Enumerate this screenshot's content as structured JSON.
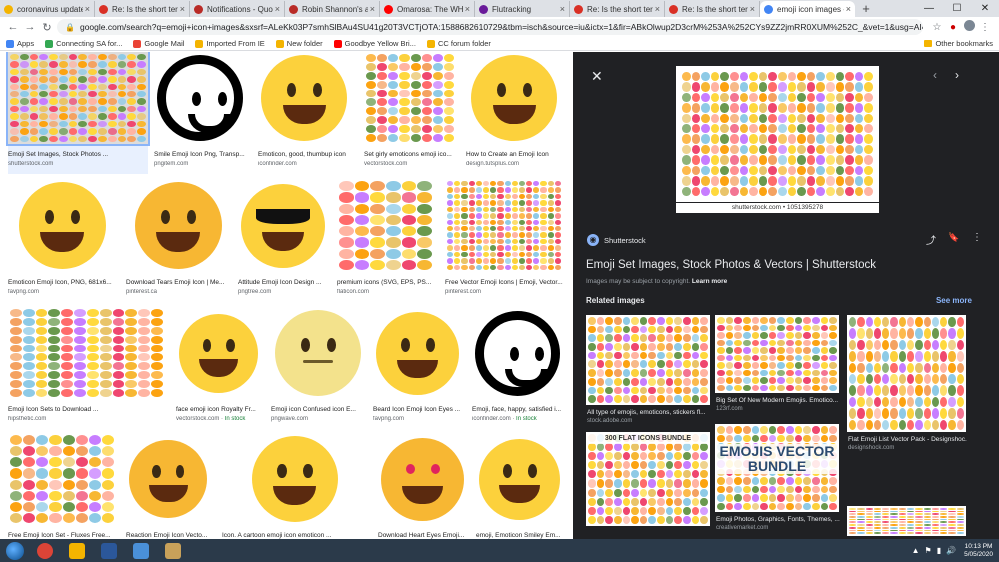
{
  "tabs": [
    {
      "label": "coronavirus update we",
      "fav_color": "#f4b400",
      "active": false
    },
    {
      "label": "Re: Is the short term re",
      "fav_color": "#d93025",
      "active": false
    },
    {
      "label": "Notifications - Quora",
      "fav_color": "#b92b27",
      "active": false
    },
    {
      "label": "Robin Shannon's answe",
      "fav_color": "#b92b27",
      "active": false
    },
    {
      "label": "Omarosa: The WH Com",
      "fav_color": "#ff0000",
      "active": false
    },
    {
      "label": "Flutracking",
      "fav_color": "#6a1b9a",
      "active": false
    },
    {
      "label": "Re: Is the short term re",
      "fav_color": "#d93025",
      "active": false
    },
    {
      "label": "Re: Is the short term re",
      "fav_color": "#d93025",
      "active": false
    },
    {
      "label": "emoji icon images - Go",
      "fav_color": "#4285f4",
      "active": true
    }
  ],
  "toolbar": {
    "url": "google.com/search?q=emoji+icon+images&sxsrf=ALeKk03P7smhSlBAu4SU41g20T3VCTjOTA:1588682610729&tbm=isch&source=iu&ictx=1&fir=ABkOlwup2D3crM%253A%252CYs9ZZ2jmRR0XUM%252C_&vet=1&usg=AI4_-kS-P-qUCoh-2854OWqtAGyH6zdp...",
    "back": "←",
    "forward": "→",
    "reload": "↻",
    "star": "☆",
    "menu": "⋮",
    "newtab": "+",
    "win_min": "—",
    "win_max": "☐",
    "win_close": "✕",
    "close_icon": "×",
    "lock": "🔒"
  },
  "bookmarks": [
    {
      "label": "Apps",
      "color": "#4285f4"
    },
    {
      "label": "Connecting SA for...",
      "color": "#34a853"
    },
    {
      "label": "Google Mail",
      "color": "#ea4335"
    },
    {
      "label": "Imported From IE",
      "color": "#f4b400"
    },
    {
      "label": "New folder",
      "color": "#f4b400"
    },
    {
      "label": "Goodbye Yellow Bri...",
      "color": "#ff0000"
    },
    {
      "label": "CC forum folder",
      "color": "#f4b400"
    }
  ],
  "bookmarks_other": "Other bookmarks",
  "results": [
    {
      "caption": "Emoji Set Images, Stock Photos ...",
      "source": "shutterstock.com",
      "stock": ""
    },
    {
      "caption": "Smile Emoji Icon Png, Transp...",
      "source": "pngitem.com",
      "stock": ""
    },
    {
      "caption": "Emoticon, good, thumbup icon",
      "source": "iconfinder.com",
      "stock": ""
    },
    {
      "caption": "Set girly emoticons emoji ico...",
      "source": "vectorstock.com",
      "stock": ""
    },
    {
      "caption": "How to Create an Emoji Icon",
      "source": "design.tutsplus.com",
      "stock": ""
    },
    {
      "caption": "Emoticon Emoji Icon, PNG, 681x6...",
      "source": "favpng.com",
      "stock": ""
    },
    {
      "caption": "Download Tears Emoji Icon | Me...",
      "source": "pinterest.ca",
      "stock": ""
    },
    {
      "caption": "Attitude Emoji Icon Design ...",
      "source": "pngtree.com",
      "stock": ""
    },
    {
      "caption": "premium icons (SVG, EPS, PS...",
      "source": "flaticon.com",
      "stock": ""
    },
    {
      "caption": "Free Vector Emoji Icons | Emoji, Vector...",
      "source": "pinterest.com",
      "stock": ""
    },
    {
      "caption": "Emoji Icon Sets to Download ...",
      "source": "hipsthetic.com",
      "stock": ""
    },
    {
      "caption": "face emoji icon Royalty Fr...",
      "source": "vectorstock.com",
      "stock": "In stock"
    },
    {
      "caption": "Emoji icon Confused icon E...",
      "source": "pngwave.com",
      "stock": ""
    },
    {
      "caption": "Beard Icon Emoji Icon Eyes ...",
      "source": "favpng.com",
      "stock": ""
    },
    {
      "caption": "Emoji, face, happy, satisfied i...",
      "source": "iconfinder.com",
      "stock": "In stock"
    },
    {
      "caption": "Free Emoji Icon Set - Fluxes Free...",
      "source": "",
      "stock": ""
    },
    {
      "caption": "Reaction Emoji Icon Vecto...",
      "source": "",
      "stock": ""
    },
    {
      "caption": "Icon. A cartoon emoji icon emoticon ...",
      "source": "",
      "stock": ""
    },
    {
      "caption": "Download Heart Eyes Emoji...",
      "source": "",
      "stock": ""
    },
    {
      "caption": "emoji, Emoticon Smiley Em...",
      "source": "",
      "stock": ""
    }
  ],
  "panel": {
    "image_caption": "shutterstock.com • 1051395278",
    "source_name": "Shutterstock",
    "title": "Emoji Set Images, Stock Photos & Vectors | Shutterstock",
    "note": "Images may be subject to copyright.",
    "learn_more": "Learn more",
    "related_heading": "Related images",
    "see_more": "See more",
    "icons": {
      "close": "✕",
      "prev": "‹",
      "next": "›",
      "share": "⤴",
      "save": "🔖",
      "more": "⋮"
    },
    "related": [
      {
        "caption": "All type of emojis, emoticons, stickers fl...",
        "source": "stock.adobe.com"
      },
      {
        "caption": "Big Set Of New Modern Emojis. Emotico...",
        "source": "123rf.com"
      },
      {
        "caption": "Flat Emoji List Vector Pack - Designshoc...",
        "source": "designshock.com"
      },
      {
        "caption": "",
        "source": "",
        "banner": "300 FLAT ICONS BUNDLE"
      },
      {
        "caption": "Emoji Photos, Graphics, Fonts, Themes, ...",
        "source": "creativemarket.com",
        "banner": "EMOJIS VECTOR BUNDLE"
      },
      {
        "caption": "",
        "source": ""
      }
    ]
  },
  "taskbar": {
    "time": "10:13 PM",
    "date": "5/05/2020",
    "apps": [
      {
        "name": "chrome",
        "color": "#db4437"
      },
      {
        "name": "folder",
        "color": "#f4b400"
      },
      {
        "name": "word",
        "color": "#2b579a"
      },
      {
        "name": "explorer",
        "color": "#4a90d9"
      },
      {
        "name": "files",
        "color": "#c8a15a"
      }
    ],
    "tray_icons": [
      "▲",
      "⚑",
      "▮",
      "🔊"
    ]
  },
  "colors": {
    "emoji_yellow": "#fcd13c",
    "panel_bg": "#202124",
    "link_blue": "#8ab4f8"
  }
}
